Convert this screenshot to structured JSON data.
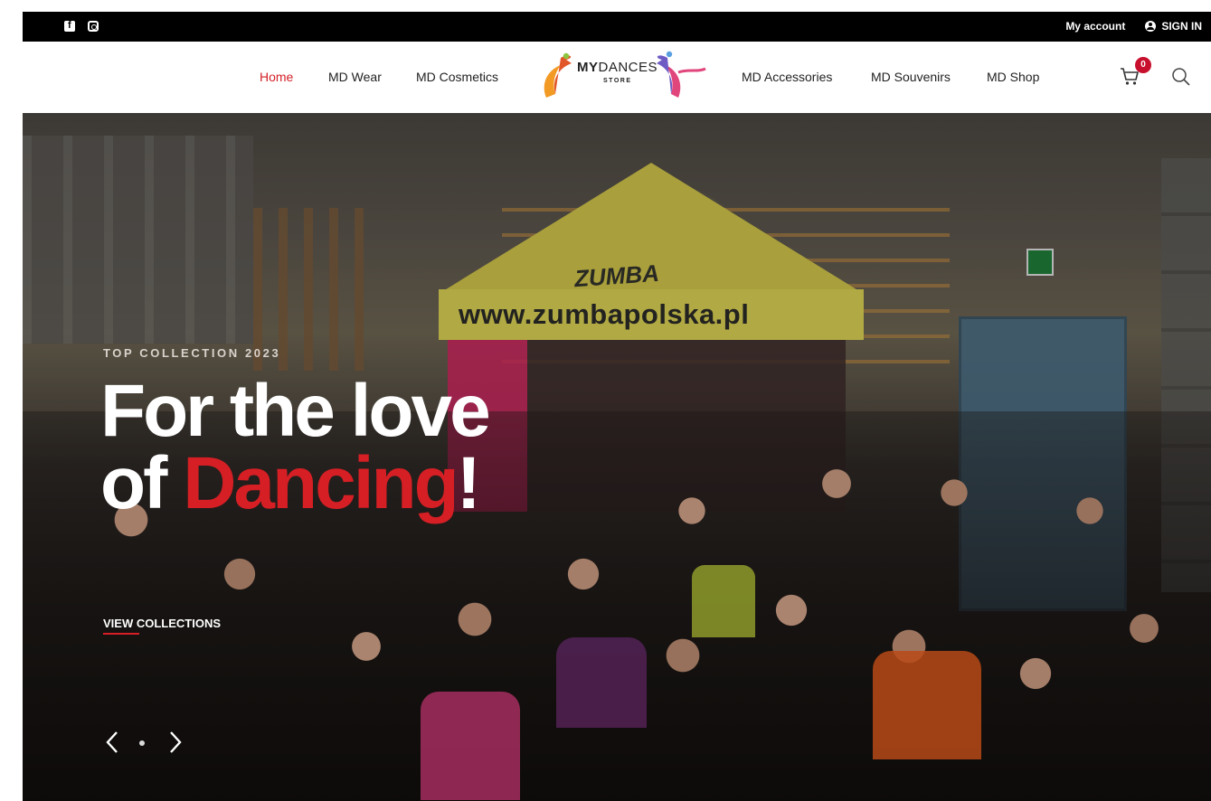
{
  "topbar": {
    "social": [
      {
        "icon": "facebook-icon"
      },
      {
        "icon": "instagram-icon"
      }
    ],
    "my_account": "My account",
    "sign_in": "SIGN IN"
  },
  "nav": {
    "items": [
      {
        "label": "Home",
        "active": true
      },
      {
        "label": "MD Wear"
      },
      {
        "label": "MD Cosmetics"
      },
      {
        "label": "MD Accessories"
      },
      {
        "label": "MD Souvenirs"
      },
      {
        "label": "MD Shop"
      }
    ],
    "logo": {
      "brand_my": "MY",
      "brand_dances": "DANCES",
      "sub": "STORE"
    },
    "cart_count": "0"
  },
  "hero": {
    "eyebrow": "TOP COLLECTION 2023",
    "headline_line1": "For the love",
    "headline_prefix": "of ",
    "headline_accent": "Dancing",
    "headline_suffix": "!",
    "cta": "VIEW COLLECTIONS",
    "photo_banner": "www.zumbapolska.pl",
    "photo_tent": "ZUMBA"
  },
  "colors": {
    "accent": "#d51f24",
    "topbar": "#000000",
    "badge": "#c8102e"
  }
}
